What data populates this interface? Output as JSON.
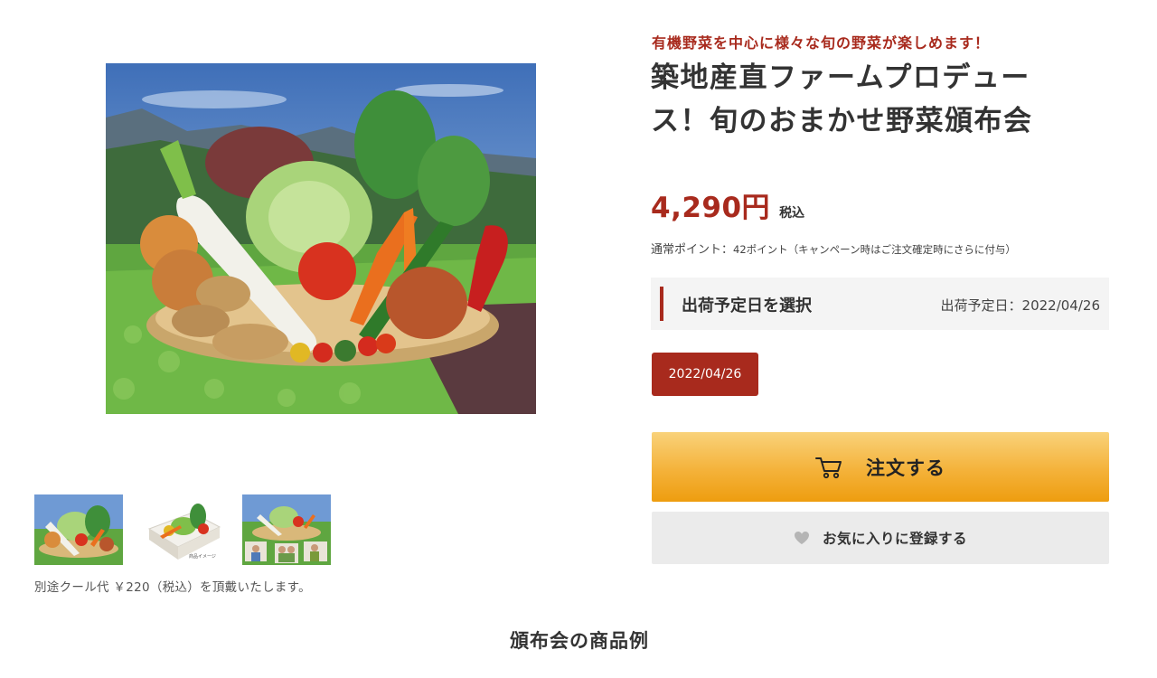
{
  "gallery": {
    "thumbnails": [
      {
        "alt": "vegetable-basket-thumbnail"
      },
      {
        "alt": "vegetable-box-thumbnail",
        "caption": "商品イメージ"
      },
      {
        "alt": "farm-producers-thumbnail"
      }
    ],
    "cool_note": "別途クール代 ￥220（税込）を頂戴いたします。"
  },
  "product": {
    "catch_copy": "有機野菜を中心に様々な旬の野菜が楽しめます！",
    "title_line1": "築地産直ファームプロデュー",
    "title_line2": "ス！旬のおまかせ野菜頒布会",
    "price": "4,290円",
    "tax_label": "税込",
    "points_label": "通常ポイント：",
    "points_value": "42ポイント",
    "points_note": "（キャンペーン時はご注文確定時にさらに付与）"
  },
  "shipping": {
    "section_label": "出荷予定日を選択",
    "date_label": "出荷予定日：2022/04/26",
    "options": [
      "2022/04/26"
    ]
  },
  "actions": {
    "order_label": "注文する",
    "favorite_label": "お気に入りに登録する"
  },
  "section": {
    "title": "頒布会の商品例"
  },
  "colors": {
    "accent": "#a82a1d",
    "order_button": "#f4b23a",
    "favorite_button": "#ebebeb"
  },
  "icons": {
    "order": "cart-icon",
    "favorite": "heart-icon"
  }
}
